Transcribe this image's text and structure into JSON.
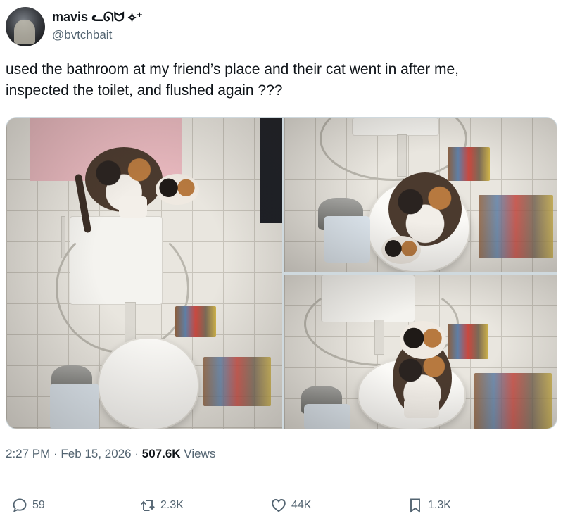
{
  "author": {
    "name": "mavis ᓚᘏᗢ ⟡⁺",
    "handle": "@bvtchbait"
  },
  "tweet": {
    "text": "used the bathroom at my friend’s place and their cat went in after me,\ninspected the toilet, and flushed again ???"
  },
  "media": {
    "photo_count": 3
  },
  "meta": {
    "time": "2:27 PM",
    "separator_1": " · ",
    "date": "Feb 15, 2026",
    "separator_2": " · ",
    "views_count": "507.6K",
    "views_label": " Views"
  },
  "actions": {
    "replies": "59",
    "reposts": "2.3K",
    "likes": "44K",
    "bookmarks": "1.3K"
  },
  "icons": {
    "reply": "reply-icon",
    "repost": "repost-icon",
    "like": "heart-icon",
    "bookmark": "bookmark-icon"
  },
  "colors": {
    "text_primary": "#0f1419",
    "text_secondary": "#536471",
    "divider": "#eff3f4",
    "media_border": "#cfd9de"
  }
}
